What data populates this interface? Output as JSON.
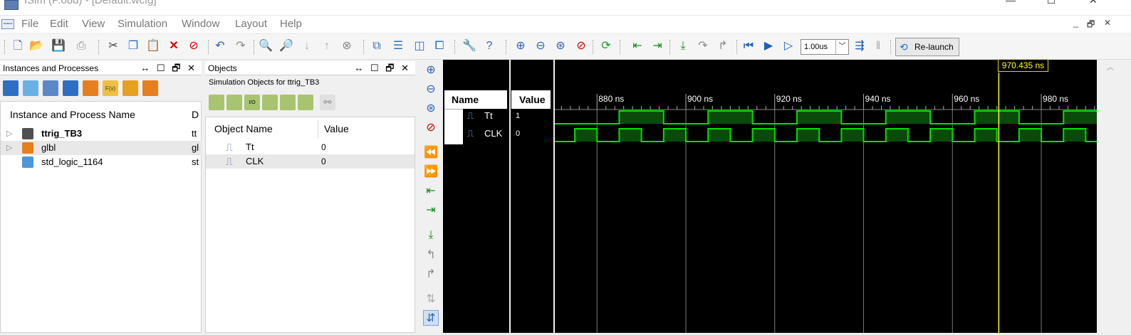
{
  "window": {
    "title": "ISim (P.68d) - [Default.wcfg]",
    "btn_min": "—",
    "btn_max": "☐",
    "btn_close": "✕"
  },
  "menu": {
    "items": [
      "File",
      "Edit",
      "View",
      "Simulation",
      "Window",
      "Layout",
      "Help"
    ],
    "mdi": [
      "_",
      "🗗",
      "✕"
    ],
    "icon": "waveform-icon"
  },
  "toolbar": {
    "run_time": "1.00us",
    "relaunch_label": "Re-launch"
  },
  "instances": {
    "panel_title": "Instances and Processes",
    "panel_controls": "↔ ☐ 🗗 ✕",
    "col_name": "Instance and Process Name",
    "col_d": "D",
    "rows": [
      {
        "name": "ttrig_TB3",
        "d": "tt",
        "bold": true,
        "expand": "▷",
        "color": "#505050"
      },
      {
        "name": "glbl",
        "d": "gl",
        "bold": false,
        "expand": "▷",
        "color": "#e87e1c"
      },
      {
        "name": "std_logic_1164",
        "d": "st",
        "bold": false,
        "expand": "",
        "color": "#4a98d8"
      }
    ]
  },
  "objects": {
    "panel_title": "Objects",
    "panel_controls": "↔ ☐ 🗗 ✕",
    "subtitle": "Simulation Objects for ttrig_TB3",
    "col_name": "Object Name",
    "col_value": "Value",
    "rows": [
      {
        "name": "Tt",
        "value": "0"
      },
      {
        "name": "CLK",
        "value": "0"
      }
    ]
  },
  "wave": {
    "col_name": "Name",
    "col_value": "Value",
    "signals": [
      {
        "name": "Tt",
        "value": "1"
      },
      {
        "name": "CLK",
        "value": "0"
      }
    ],
    "cursor_label": "970.435 ns",
    "colors": {
      "wave": "#00e000",
      "fill": "#0a4a0a",
      "cursor": "#ffff00",
      "bg": "#000000"
    }
  },
  "chart_data": {
    "type": "line",
    "title": "",
    "xlabel": "",
    "ylabel": "",
    "x_unit": "ns",
    "tick_labels": [
      "880 ns",
      "900 ns",
      "920 ns",
      "940 ns",
      "960 ns",
      "980 ns"
    ],
    "xlim": [
      870.5,
      992.5
    ],
    "cursor_ns": 970.435,
    "series": [
      {
        "name": "Tt",
        "edges_ns": [
          870.5,
          885,
          895,
          905,
          915,
          925,
          935,
          945,
          955,
          965,
          975,
          985,
          992.5
        ],
        "levels": [
          0,
          1,
          0,
          1,
          0,
          1,
          0,
          1,
          0,
          1,
          0,
          1
        ]
      },
      {
        "name": "CLK",
        "edges_ns": [
          870.5,
          875,
          880,
          885,
          890,
          895,
          900,
          905,
          910,
          915,
          920,
          925,
          930,
          935,
          940,
          945,
          950,
          955,
          960,
          965,
          970,
          975,
          980,
          985,
          990,
          992.5
        ],
        "levels": [
          0,
          1,
          0,
          1,
          0,
          1,
          0,
          1,
          0,
          1,
          0,
          1,
          0,
          1,
          0,
          1,
          0,
          1,
          0,
          1,
          0,
          1,
          0,
          1,
          0
        ]
      }
    ]
  }
}
